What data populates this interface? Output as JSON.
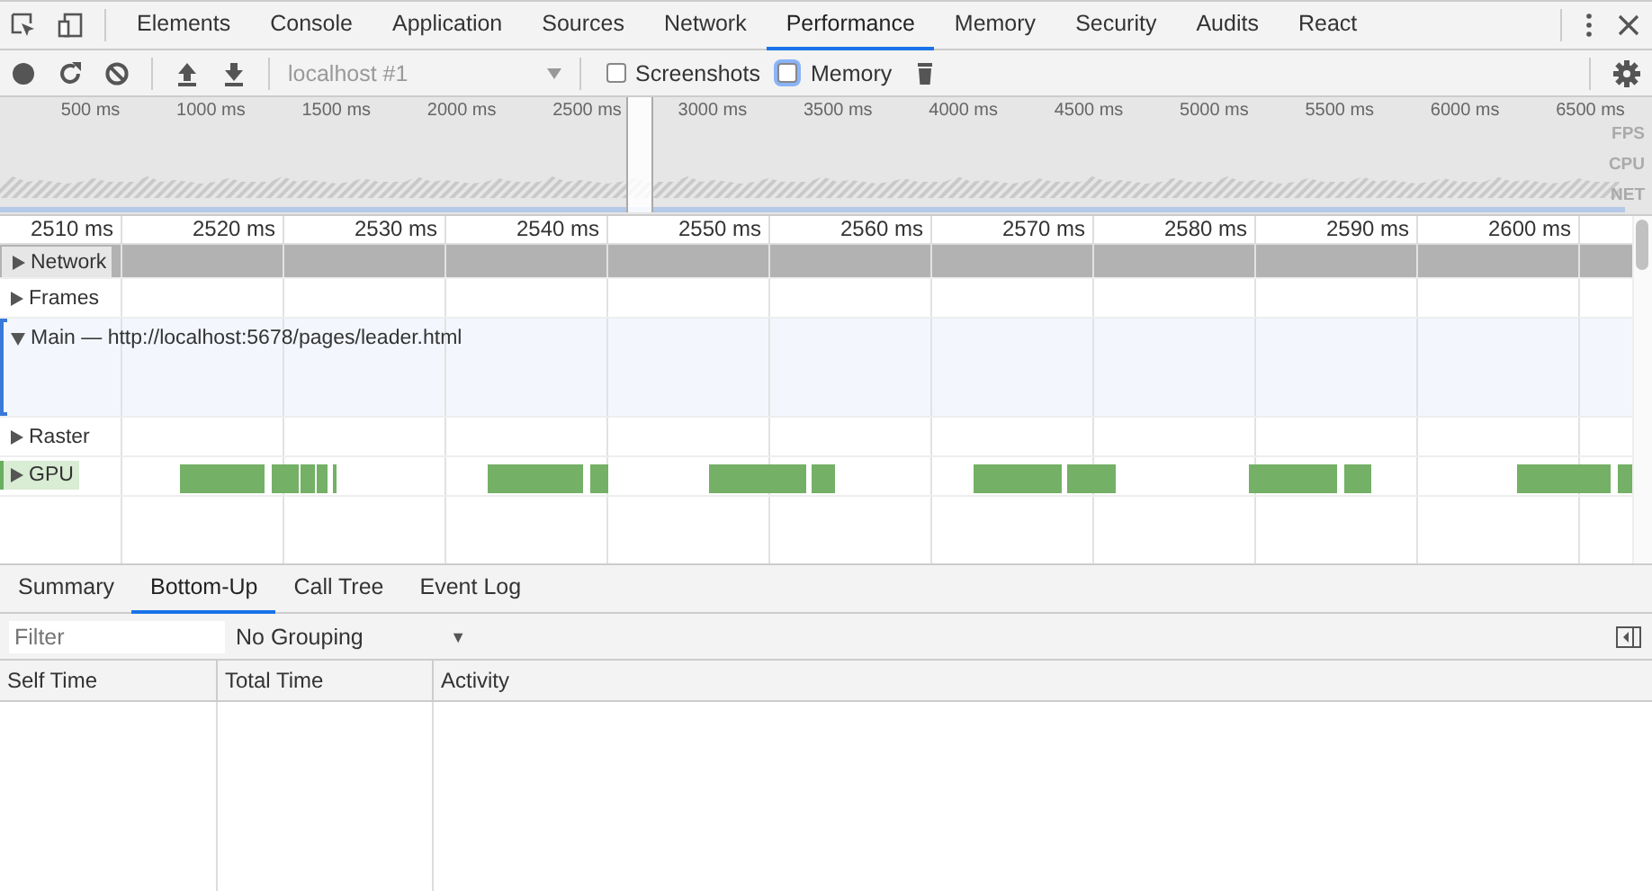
{
  "tabs": [
    {
      "label": "Elements",
      "selected": false
    },
    {
      "label": "Console",
      "selected": false
    },
    {
      "label": "Application",
      "selected": false
    },
    {
      "label": "Sources",
      "selected": false
    },
    {
      "label": "Network",
      "selected": false
    },
    {
      "label": "Performance",
      "selected": true
    },
    {
      "label": "Memory",
      "selected": false
    },
    {
      "label": "Security",
      "selected": false
    },
    {
      "label": "Audits",
      "selected": false
    },
    {
      "label": "React",
      "selected": false
    }
  ],
  "toolbar": {
    "target": {
      "value": "localhost #1",
      "disabled": true
    },
    "options": [
      {
        "label": "Screenshots",
        "checked": false,
        "focused": false
      },
      {
        "label": "Memory",
        "checked": false,
        "focused": true
      }
    ]
  },
  "overview": {
    "ticks": [
      "500 ms",
      "1000 ms",
      "1500 ms",
      "2000 ms",
      "2500 ms",
      "3000 ms",
      "3500 ms",
      "4000 ms",
      "4500 ms",
      "5000 ms",
      "5500 ms",
      "6000 ms",
      "6500 ms"
    ],
    "lanes": [
      "FPS",
      "CPU",
      "NET"
    ]
  },
  "ruler": [
    "2510 ms",
    "2520 ms",
    "2530 ms",
    "2540 ms",
    "2550 ms",
    "2560 ms",
    "2570 ms",
    "2580 ms",
    "2590 ms",
    "2600 ms"
  ],
  "tracks": [
    {
      "label": "Network",
      "kind": "network",
      "expanded": false,
      "selected": false
    },
    {
      "label": "Frames",
      "kind": "plain",
      "expanded": false,
      "selected": false
    },
    {
      "label": "Main — http://localhost:5678/pages/leader.html",
      "kind": "main",
      "expanded": true,
      "selected": true
    },
    {
      "label": "Raster",
      "kind": "plain",
      "expanded": false,
      "selected": false
    },
    {
      "label": "GPU",
      "kind": "gpu",
      "expanded": false,
      "selected": false
    }
  ],
  "details": {
    "tabs": [
      {
        "label": "Summary",
        "selected": false
      },
      {
        "label": "Bottom-Up",
        "selected": true
      },
      {
        "label": "Call Tree",
        "selected": false
      },
      {
        "label": "Event Log",
        "selected": false
      }
    ],
    "filter": {
      "placeholder": "Filter"
    },
    "grouping": {
      "value": "No Grouping",
      "arrow": "▼"
    },
    "columns": [
      "Self Time",
      "Total Time",
      "Activity"
    ]
  }
}
